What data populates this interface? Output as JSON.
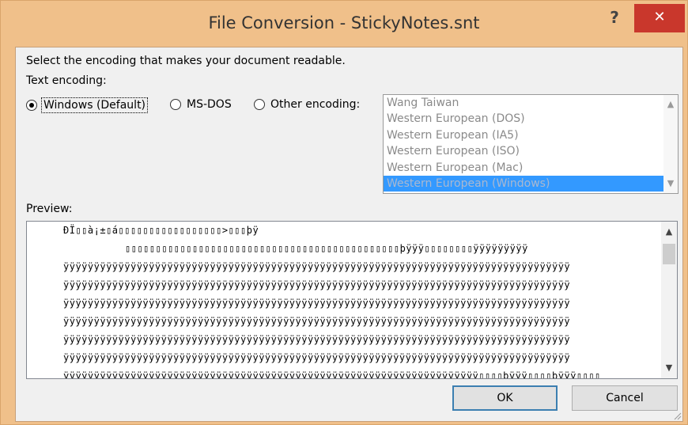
{
  "window": {
    "title": "File Conversion - StickyNotes.snt",
    "help_label": "?",
    "close_label": "✕"
  },
  "instructions": "Select the encoding that makes your document readable.",
  "text_encoding_label": "Text encoding:",
  "encoding_options": [
    {
      "label": "Windows (Default)",
      "selected": true
    },
    {
      "label": "MS-DOS",
      "selected": false
    },
    {
      "label": "Other encoding:",
      "selected": false
    }
  ],
  "encoding_list": {
    "items": [
      "Wang Taiwan",
      "Western European (DOS)",
      "Western European (IA5)",
      "Western European (ISO)",
      "Western European (Mac)",
      "Western European (Windows)"
    ],
    "selected": "Western European (Windows)"
  },
  "preview": {
    "label": "Preview:",
    "lines": [
      "ÐÏ▯▯à¡±▯á▯▯▯▯▯▯▯▯▯▯▯▯▯▯▯▯▯>▯▯▯þÿ",
      "▯▯▯▯▯▯▯▯▯▯▯▯▯▯▯▯▯▯▯▯▯▯▯▯▯▯▯▯▯▯▯▯▯▯▯▯▯▯▯▯▯▯▯▯▯þÿÿÿ▯▯▯▯▯▯▯▯ÿÿÿÿÿÿÿÿÿ",
      "ÿÿÿÿÿÿÿÿÿÿÿÿÿÿÿÿÿÿÿÿÿÿÿÿÿÿÿÿÿÿÿÿÿÿÿÿÿÿÿÿÿÿÿÿÿÿÿÿÿÿÿÿÿÿÿÿÿÿÿÿÿÿÿÿÿÿÿÿÿÿÿÿÿÿÿÿÿÿÿÿÿÿÿ",
      "ÿÿÿÿÿÿÿÿÿÿÿÿÿÿÿÿÿÿÿÿÿÿÿÿÿÿÿÿÿÿÿÿÿÿÿÿÿÿÿÿÿÿÿÿÿÿÿÿÿÿÿÿÿÿÿÿÿÿÿÿÿÿÿÿÿÿÿÿÿÿÿÿÿÿÿÿÿÿÿÿÿÿÿ",
      "ÿÿÿÿÿÿÿÿÿÿÿÿÿÿÿÿÿÿÿÿÿÿÿÿÿÿÿÿÿÿÿÿÿÿÿÿÿÿÿÿÿÿÿÿÿÿÿÿÿÿÿÿÿÿÿÿÿÿÿÿÿÿÿÿÿÿÿÿÿÿÿÿÿÿÿÿÿÿÿÿÿÿÿ",
      "ÿÿÿÿÿÿÿÿÿÿÿÿÿÿÿÿÿÿÿÿÿÿÿÿÿÿÿÿÿÿÿÿÿÿÿÿÿÿÿÿÿÿÿÿÿÿÿÿÿÿÿÿÿÿÿÿÿÿÿÿÿÿÿÿÿÿÿÿÿÿÿÿÿÿÿÿÿÿÿÿÿÿÿ",
      "ÿÿÿÿÿÿÿÿÿÿÿÿÿÿÿÿÿÿÿÿÿÿÿÿÿÿÿÿÿÿÿÿÿÿÿÿÿÿÿÿÿÿÿÿÿÿÿÿÿÿÿÿÿÿÿÿÿÿÿÿÿÿÿÿÿÿÿÿÿÿÿÿÿÿÿÿÿÿÿÿÿÿÿ",
      "ÿÿÿÿÿÿÿÿÿÿÿÿÿÿÿÿÿÿÿÿÿÿÿÿÿÿÿÿÿÿÿÿÿÿÿÿÿÿÿÿÿÿÿÿÿÿÿÿÿÿÿÿÿÿÿÿÿÿÿÿÿÿÿÿÿÿÿÿÿÿÿÿÿÿÿÿÿÿÿÿÿÿÿ",
      "ÿÿÿÿÿÿÿÿÿÿÿÿÿÿÿÿÿÿÿÿÿÿÿÿÿÿÿÿÿÿÿÿÿÿÿÿÿÿÿÿÿÿÿÿÿÿÿÿÿÿÿÿÿÿÿÿÿÿÿÿÿÿÿÿÿÿÿÿÿÿÿÿÿÿÿÿÿÿÿÿÿÿÿ",
      "ÿÿÿÿÿÿÿÿÿÿÿÿÿÿÿÿÿÿÿÿÿÿÿÿÿÿÿÿÿÿÿÿÿÿÿÿÿÿÿÿÿÿÿÿÿÿÿÿÿÿÿÿÿÿÿÿÿÿÿÿÿÿÿÿÿÿÿÿ▯▯▯▯þÿÿÿ▯▯▯▯þÿÿÿ▯▯▯▯"
    ]
  },
  "buttons": {
    "ok": "OK",
    "cancel": "Cancel"
  },
  "colors": {
    "frame": "#f0c08a",
    "close": "#c9372c",
    "selection": "#3399ff",
    "default_button_border": "#3c7fb1"
  }
}
